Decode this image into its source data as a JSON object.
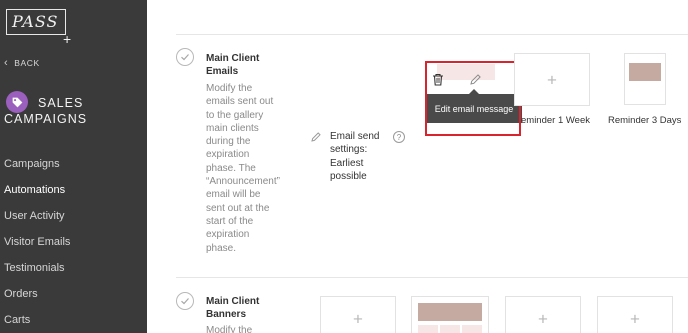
{
  "sidebar": {
    "logo_text": "PASS",
    "logo_plus": "+",
    "back_label": "BACK",
    "brand_line1": "SALES",
    "brand_line2": "CAMPAIGNS",
    "nav": [
      {
        "label": "Campaigns",
        "active": false
      },
      {
        "label": "Automations",
        "active": true
      },
      {
        "label": "User Activity",
        "active": false
      },
      {
        "label": "Visitor Emails",
        "active": false
      },
      {
        "label": "Testimonials",
        "active": false
      },
      {
        "label": "Orders",
        "active": false
      },
      {
        "label": "Carts",
        "active": false
      }
    ]
  },
  "main": {
    "section1": {
      "title": "Main Client Emails",
      "title_line1": "Main Client",
      "title_line2": "Emails",
      "desc_lines": [
        "Modify the",
        "emails sent out",
        "to the gallery",
        "main clients",
        "during the",
        "expiration",
        "phase. The",
        "“Announcement”",
        "email will be",
        "sent out at the",
        "start of the",
        "expiration",
        "phase."
      ],
      "send_lines": [
        "Email send",
        "settings:",
        "Earliest",
        "possible"
      ],
      "help": "?",
      "tooltip": "Edit email message",
      "cards": [
        {
          "label": "Reminder 1 Week",
          "visible_label": "eminder 1 Week"
        },
        {
          "label": "Reminder 3 Days"
        }
      ],
      "plus": "+"
    },
    "section2": {
      "title_line1": "Main Client",
      "title_line2": "Banners",
      "desc_partial": "Modify the",
      "plus": "+"
    }
  },
  "colors": {
    "sidebar_bg": "#3a3a3a",
    "brand_purple": "#9b5fbd",
    "thumb": "#c4aaa0",
    "highlight_red": "#d8242f",
    "tooltip_bg": "#4a4a4a"
  },
  "icons": [
    "chevron-left-icon",
    "tag-icon",
    "check-icon",
    "pencil-icon",
    "trash-icon",
    "help-icon",
    "plus-icon"
  ]
}
